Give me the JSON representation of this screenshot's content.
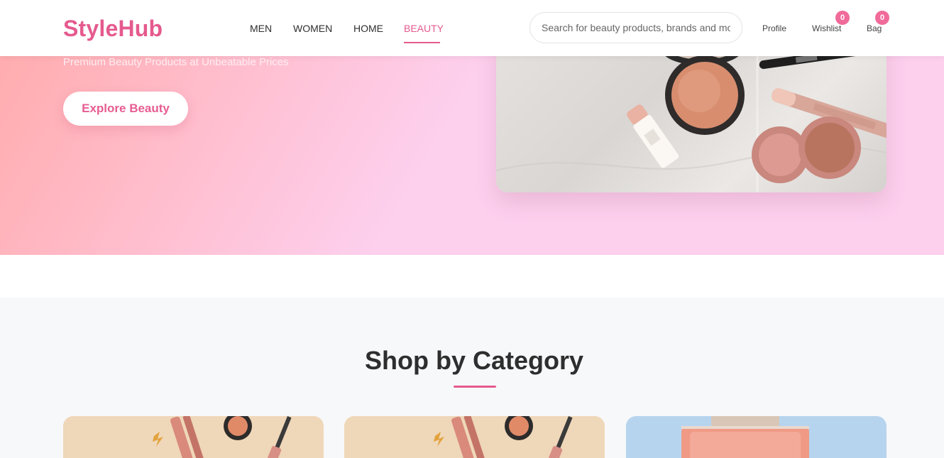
{
  "brand": {
    "logo": "StyleHub",
    "accent": "#e55a8e"
  },
  "nav": {
    "items": [
      {
        "label": "MEN",
        "active": false
      },
      {
        "label": "WOMEN",
        "active": false
      },
      {
        "label": "HOME",
        "active": false
      },
      {
        "label": "BEAUTY",
        "active": true
      }
    ]
  },
  "search": {
    "placeholder": "Search for beauty products, brands and more",
    "value": ""
  },
  "header_actions": {
    "profile": {
      "label": "Profile"
    },
    "wishlist": {
      "label": "Wishlist",
      "count": "0"
    },
    "bag": {
      "label": "Bag",
      "count": "0"
    }
  },
  "hero": {
    "subtitle": "Premium Beauty Products at Unbeatable Prices",
    "cta_label": "Explore Beauty"
  },
  "categories": {
    "title": "Shop by Category"
  }
}
